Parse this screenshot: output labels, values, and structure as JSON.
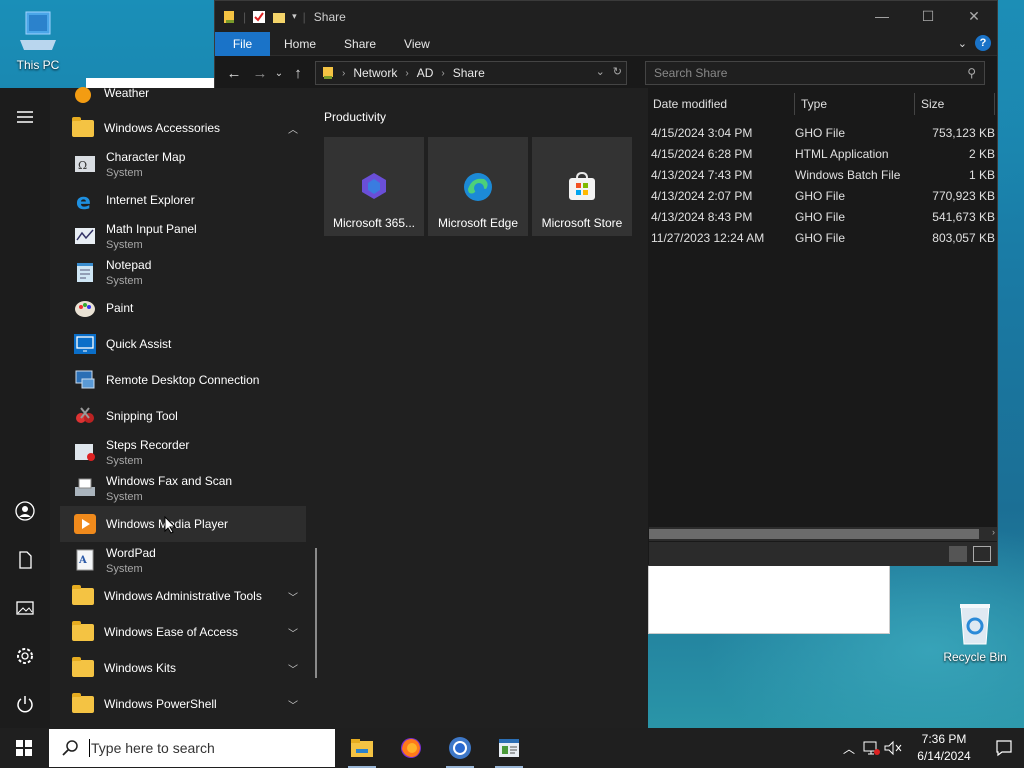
{
  "desktop": {
    "icons": [
      {
        "label": "This PC",
        "icon": "computer-icon"
      },
      {
        "label": "Recycle Bin",
        "icon": "recycle-bin-icon"
      }
    ]
  },
  "explorer": {
    "title": "Share",
    "ribbon_tabs": [
      "File",
      "Home",
      "Share",
      "View"
    ],
    "breadcrumb": [
      "Network",
      "AD",
      "Share"
    ],
    "search_placeholder": "Search Share",
    "columns": [
      "Date modified",
      "Type",
      "Size"
    ],
    "files": [
      {
        "date": "4/15/2024 3:04 PM",
        "type": "GHO File",
        "size": "753,123 KB"
      },
      {
        "date": "4/15/2024 6:28 PM",
        "type": "HTML Application",
        "size": "2 KB"
      },
      {
        "date": "4/13/2024 7:43 PM",
        "type": "Windows Batch File",
        "size": "1 KB"
      },
      {
        "date": "4/13/2024 2:07 PM",
        "type": "GHO File",
        "size": "770,923 KB"
      },
      {
        "date": "4/13/2024 8:43 PM",
        "type": "GHO File",
        "size": "541,673 KB"
      },
      {
        "date": "11/27/2023 12:24 AM",
        "type": "GHO File",
        "size": "803,057 KB"
      }
    ]
  },
  "start_menu": {
    "apps": [
      {
        "name": "Weather",
        "desc": "",
        "icon": "weather-icon"
      },
      {
        "name": "Windows Accessories",
        "desc": "",
        "icon": "folder-icon",
        "expanded": true
      },
      {
        "name": "Character Map",
        "desc": "System",
        "icon": "character-map-icon"
      },
      {
        "name": "Internet Explorer",
        "desc": "",
        "icon": "internet-explorer-icon"
      },
      {
        "name": "Math Input Panel",
        "desc": "System",
        "icon": "math-input-icon"
      },
      {
        "name": "Notepad",
        "desc": "System",
        "icon": "notepad-icon"
      },
      {
        "name": "Paint",
        "desc": "",
        "icon": "paint-icon"
      },
      {
        "name": "Quick Assist",
        "desc": "",
        "icon": "quick-assist-icon"
      },
      {
        "name": "Remote Desktop Connection",
        "desc": "",
        "icon": "remote-desktop-icon"
      },
      {
        "name": "Snipping Tool",
        "desc": "",
        "icon": "snipping-tool-icon"
      },
      {
        "name": "Steps Recorder",
        "desc": "System",
        "icon": "steps-recorder-icon"
      },
      {
        "name": "Windows Fax and Scan",
        "desc": "System",
        "icon": "fax-scan-icon"
      },
      {
        "name": "Windows Media Player",
        "desc": "",
        "icon": "media-player-icon"
      },
      {
        "name": "WordPad",
        "desc": "System",
        "icon": "wordpad-icon"
      },
      {
        "name": "Windows Administrative Tools",
        "desc": "",
        "icon": "folder-icon"
      },
      {
        "name": "Windows Ease of Access",
        "desc": "",
        "icon": "folder-icon"
      },
      {
        "name": "Windows Kits",
        "desc": "",
        "icon": "folder-icon"
      },
      {
        "name": "Windows PowerShell",
        "desc": "",
        "icon": "folder-icon"
      }
    ],
    "tiles_heading": "Productivity",
    "tiles": [
      {
        "name": "Microsoft 365...",
        "icon": "microsoft-365-icon"
      },
      {
        "name": "Microsoft Edge",
        "icon": "edge-icon"
      },
      {
        "name": "Microsoft Store",
        "icon": "store-icon"
      }
    ]
  },
  "taskbar": {
    "search_placeholder": "Type here to search",
    "apps": [
      "file-explorer-icon",
      "firefox-icon",
      "chrome-icon",
      "control-panel-icon"
    ],
    "time": "7:36 PM",
    "date": "6/14/2024"
  }
}
